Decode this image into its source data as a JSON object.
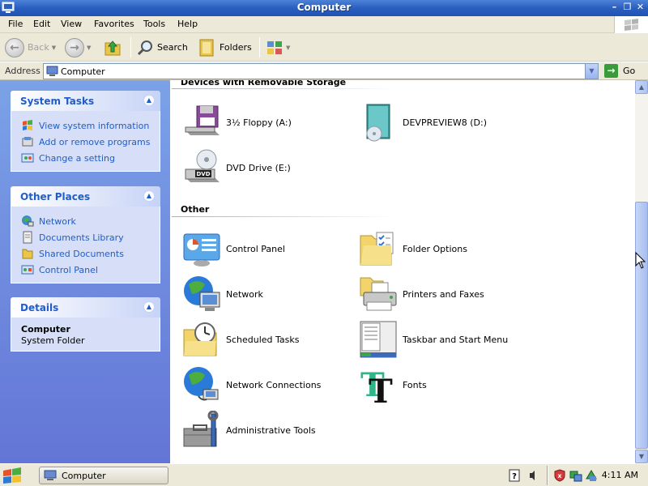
{
  "window": {
    "title": "Computer",
    "minimize_glyph": "–",
    "restore_glyph": "❐",
    "close_glyph": "✕"
  },
  "menubar": {
    "items": [
      "File",
      "Edit",
      "View",
      "Favorites",
      "Tools",
      "Help"
    ]
  },
  "toolbar": {
    "back_label": "Back",
    "search_label": "Search",
    "folders_label": "Folders"
  },
  "address": {
    "label": "Address",
    "value": "Computer",
    "go_label": "Go"
  },
  "left_pane": {
    "system_tasks": {
      "title": "System Tasks",
      "items": [
        {
          "label": "View system information",
          "icon": "system-info-icon"
        },
        {
          "label": "Add or remove programs",
          "icon": "add-remove-programs-icon"
        },
        {
          "label": "Change a setting",
          "icon": "change-setting-icon"
        }
      ]
    },
    "other_places": {
      "title": "Other Places",
      "items": [
        {
          "label": "Network",
          "icon": "network-icon"
        },
        {
          "label": "Documents Library",
          "icon": "documents-library-icon"
        },
        {
          "label": "Shared Documents",
          "icon": "shared-documents-icon"
        },
        {
          "label": "Control Panel",
          "icon": "control-panel-icon"
        }
      ]
    },
    "details": {
      "title": "Details",
      "name": "Computer",
      "type": "System Folder"
    }
  },
  "content": {
    "groups": [
      {
        "header": "Devices with Removable Storage",
        "items": [
          {
            "label": "3½ Floppy (A:)",
            "icon": "floppy-drive-icon"
          },
          {
            "label": "DEVPREVIEW8 (D:)",
            "icon": "cd-drive-icon"
          },
          {
            "label": "DVD Drive (E:)",
            "icon": "dvd-drive-icon"
          }
        ]
      },
      {
        "header": "Other",
        "items": [
          {
            "label": "Control Panel",
            "icon": "control-panel-icon"
          },
          {
            "label": "Folder Options",
            "icon": "folder-options-icon"
          },
          {
            "label": "Network",
            "icon": "network-globe-icon"
          },
          {
            "label": "Printers and Faxes",
            "icon": "printer-icon"
          },
          {
            "label": "Scheduled Tasks",
            "icon": "scheduled-tasks-icon"
          },
          {
            "label": "Taskbar and Start Menu",
            "icon": "taskbar-icon"
          },
          {
            "label": "Network Connections",
            "icon": "network-connections-icon"
          },
          {
            "label": "Fonts",
            "icon": "fonts-icon"
          },
          {
            "label": "Administrative Tools",
            "icon": "administrative-tools-icon"
          }
        ]
      }
    ]
  },
  "taskbar": {
    "window_button_label": "Computer",
    "clock": "4:11 AM"
  },
  "colors": {
    "title_bar": "#2a5fc0",
    "left_pane": "#6f8ddd",
    "task_link": "#215dc6",
    "chrome": "#ece9d8"
  }
}
